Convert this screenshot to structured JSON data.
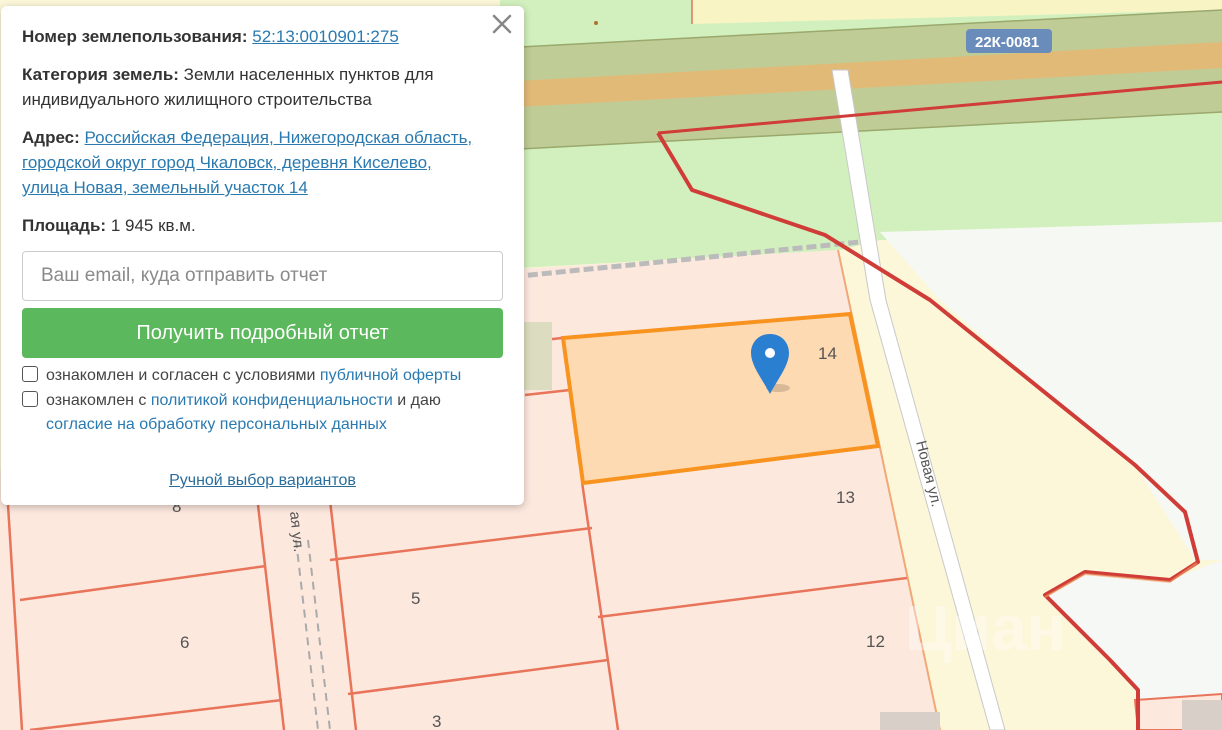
{
  "popup": {
    "cadastral_label": "Номер землепользования:",
    "cadastral_number": "52:13:0010901:275",
    "category_label": "Категория земель:",
    "category_value": "Земли населенных пунктов для индивидуального жилищного строительства",
    "address_label": "Адрес:",
    "address_line1": "Российская Федерация, Нижегородская область,",
    "address_line2": "городской округ город Чкаловск, деревня Киселево,",
    "address_line3": "улица Новая, земельный участок 14",
    "area_label": "Площадь:",
    "area_value": "1 945 кв.м.",
    "email_placeholder": "Ваш email, куда отправить отчет",
    "report_button": "Получить подробный отчет",
    "offer_text": "ознакомлен и согласен с условиями",
    "offer_link": "публичной оферты",
    "privacy_text_before": "ознакомлен с",
    "privacy_link": "политикой конфиденциальности",
    "privacy_text_after": "и даю",
    "consent_link": "согласие на обработку персональных данных",
    "manual_link": "Ручной выбор вариантов",
    "close_icon": "close-icon"
  },
  "map": {
    "road_badge": "22К-0081",
    "street_name_east": "Новая ул.",
    "street_name_west": "ая ул.",
    "watermark": "Циан",
    "parcels": [
      {
        "number": "14",
        "selected": true
      },
      {
        "number": "13"
      },
      {
        "number": "12"
      },
      {
        "number": "6"
      },
      {
        "number": "5"
      },
      {
        "number": "3"
      },
      {
        "number": "8"
      }
    ],
    "marker_icon": "map-pin-icon",
    "colors": {
      "selected_fill": "#fddab2",
      "selected_border": "#f7931e",
      "parcel_fill": "#fde8de",
      "parcel_border": "#e8745a",
      "boundary_line": "#d03c37",
      "marker": "#2b7fd0",
      "report_button": "#5cb85c"
    }
  }
}
